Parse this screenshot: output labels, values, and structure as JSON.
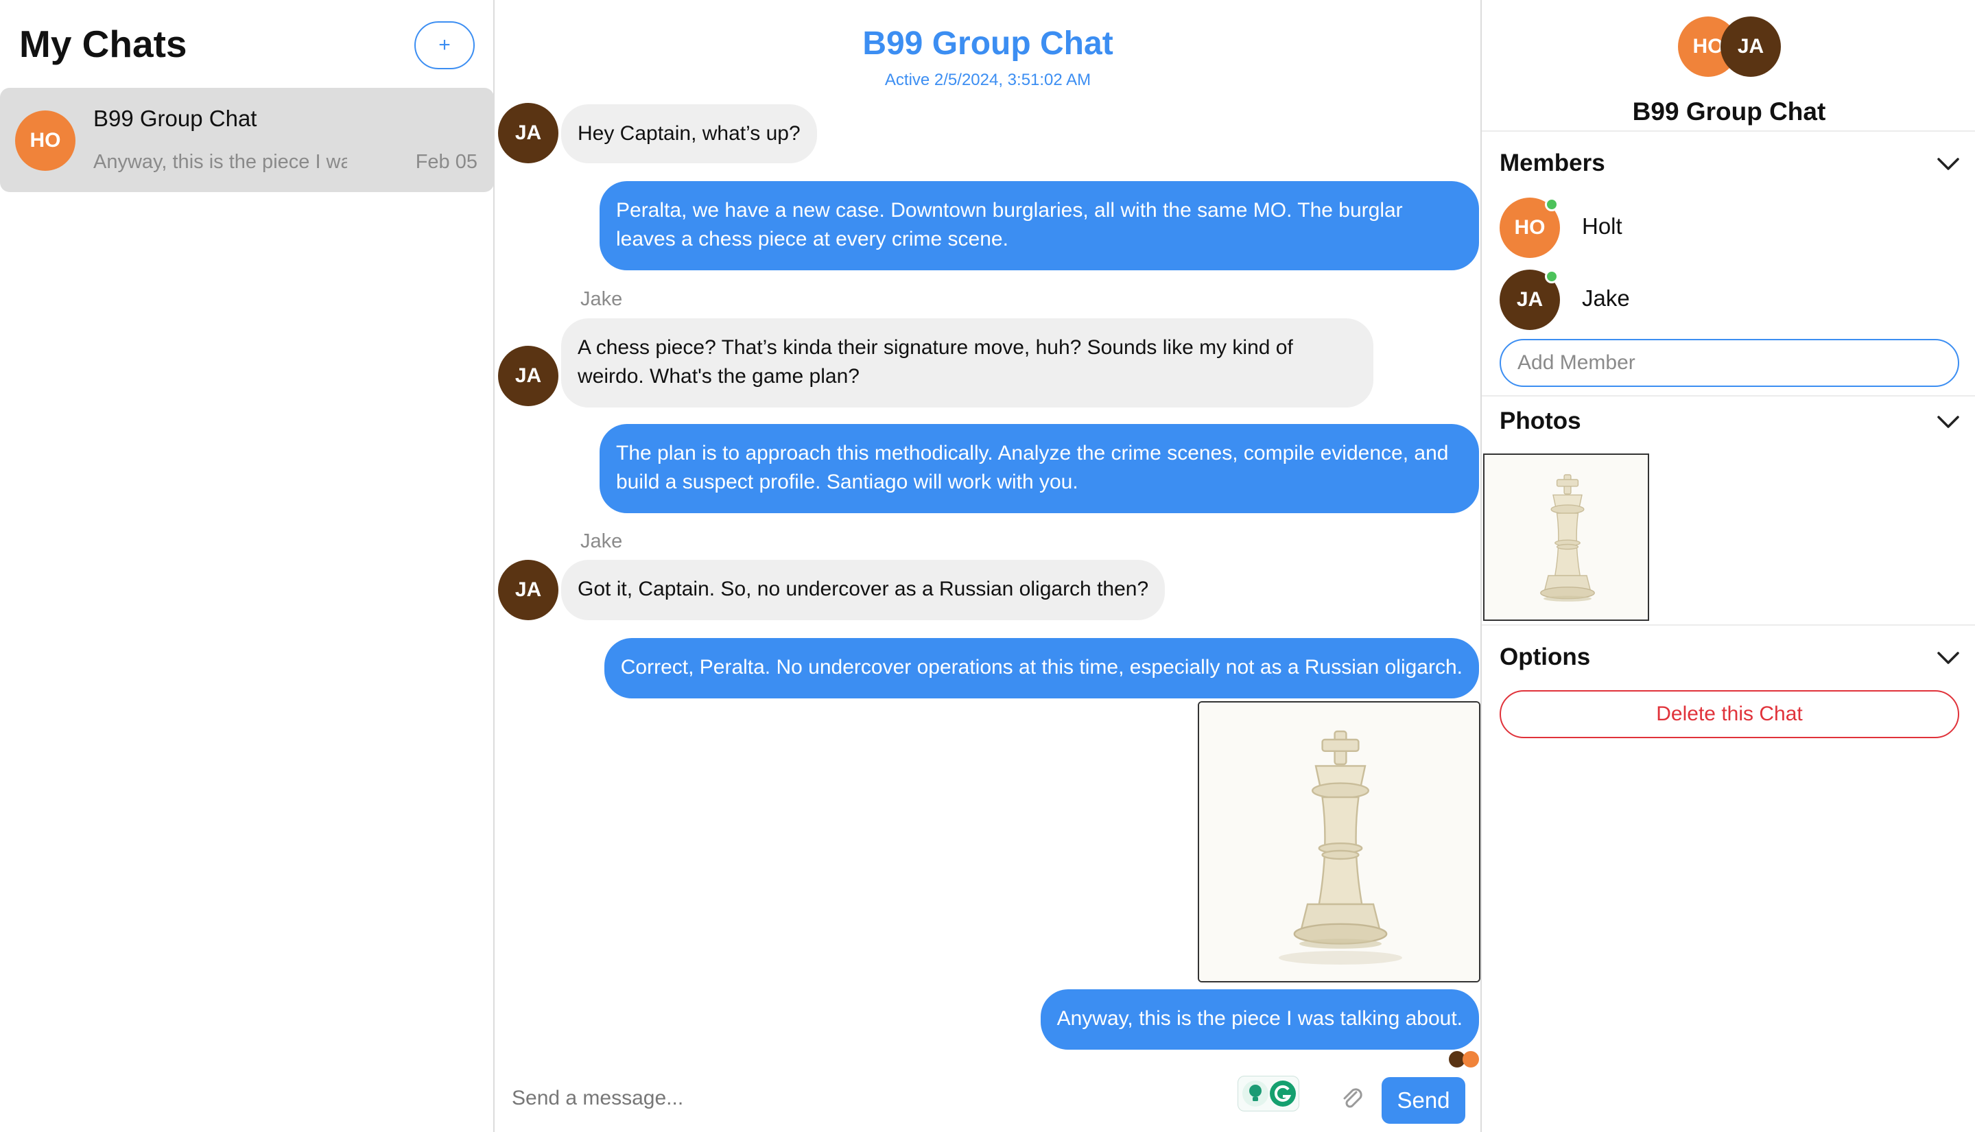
{
  "sidebar": {
    "title": "My Chats",
    "new_chat_label": "+",
    "chats": [
      {
        "initials": "HO",
        "name": "B99 Group Chat",
        "preview": "Anyway, this is the piece I was talking about.",
        "date": "Feb 05"
      }
    ]
  },
  "chat": {
    "title": "B99 Group Chat",
    "status": "Active 2/5/2024, 3:51:02 AM",
    "messages": [
      {
        "from": "Jake",
        "initials": "JA",
        "text": "Hey Captain, what’s up?"
      },
      {
        "from": "me",
        "text": "Peralta, we have a new case. Downtown burglaries, all with the same MO. The burglar leaves a chess piece at every crime scene."
      },
      {
        "from": "Jake",
        "sender_label": "Jake",
        "initials": "JA",
        "text": "A chess piece? That’s kinda their signature move, huh? Sounds like my kind of weirdo. What's the game plan?"
      },
      {
        "from": "me",
        "text": "The plan is to approach this methodically. Analyze the crime scenes, compile evidence, and build a suspect profile. Santiago will work with you."
      },
      {
        "from": "Jake",
        "sender_label": "Jake",
        "initials": "JA",
        "text": "Got it, Captain. So, no undercover as a Russian oligarch then?"
      },
      {
        "from": "me",
        "text": "Correct, Peralta. No undercover operations at this time, especially not as a Russian oligarch."
      },
      {
        "from": "me",
        "image": "chess-king-photo"
      },
      {
        "from": "me",
        "text": "Anyway, this is the piece I was talking about."
      }
    ],
    "composer_placeholder": "Send a message...",
    "send_label": "Send"
  },
  "details": {
    "avatars": [
      "HO",
      "JA"
    ],
    "name": "B99 Group Chat",
    "members_title": "Members",
    "members": [
      {
        "initials": "HO",
        "name": "Holt",
        "online": true
      },
      {
        "initials": "JA",
        "name": "Jake",
        "online": true
      }
    ],
    "add_member_placeholder": "Add Member",
    "photos_title": "Photos",
    "options_title": "Options",
    "delete_label": "Delete this Chat"
  },
  "colors": {
    "accent": "#3c8ef2",
    "holt_avatar": "#f0833a",
    "jake_avatar": "#5a3413",
    "incoming_bubble": "#efefef",
    "danger": "#e0323a",
    "online": "#4cc25a"
  }
}
